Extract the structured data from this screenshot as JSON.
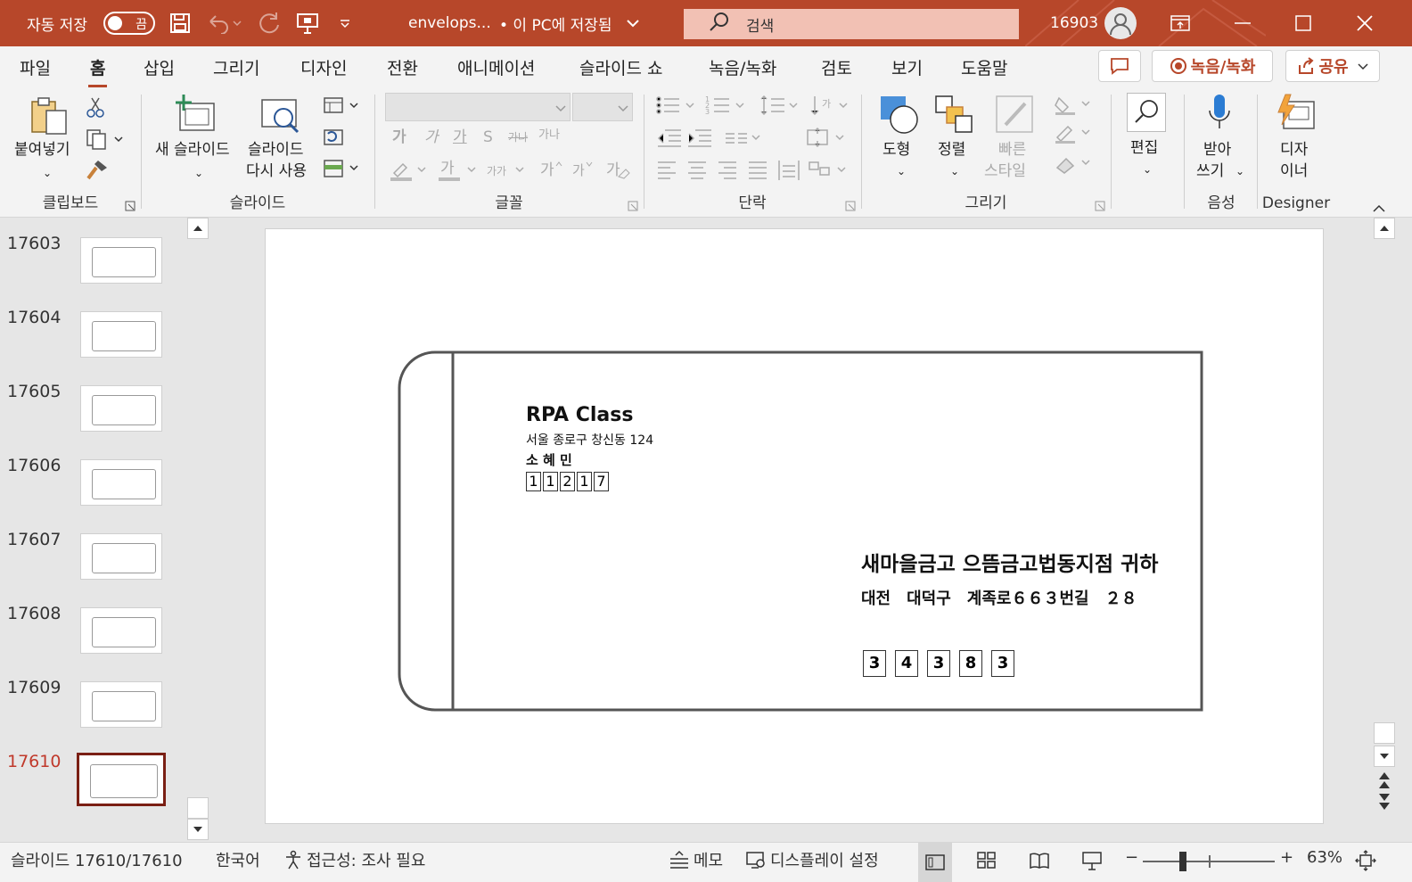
{
  "titlebar": {
    "autosave_label": "자동 저장",
    "autosave_state": "끔",
    "filename": "envelops...",
    "save_status": "• 이 PC에 저장됨",
    "search_placeholder": "검색",
    "user": "16903",
    "accent_color": "#b7472a"
  },
  "menu": {
    "tabs": [
      "파일",
      "홈",
      "삽입",
      "그리기",
      "디자인",
      "전환",
      "애니메이션",
      "슬라이드 쇼",
      "녹음/녹화",
      "검토",
      "보기",
      "도움말"
    ],
    "active": "홈",
    "record_button": "녹음/녹화",
    "share_button": "공유"
  },
  "ribbon": {
    "clipboard": {
      "paste": "붙여넣기",
      "group": "클립보드"
    },
    "slides": {
      "new_slide": "새 슬라이드",
      "reuse1": "슬라이드",
      "reuse2": "다시 사용",
      "group": "슬라이드"
    },
    "font": {
      "group": "글꼴",
      "bold": "가",
      "italic": "가",
      "underline": "가",
      "shadow": "S",
      "strike": "가나",
      "spacing": "가나"
    },
    "paragraph": {
      "group": "단락"
    },
    "drawing": {
      "shapes": "도형",
      "arrange": "정렬",
      "quick1": "빠른",
      "quick2": "스타일",
      "group": "그리기"
    },
    "editing": {
      "edit": "편집"
    },
    "voice": {
      "dictate1": "받아",
      "dictate2": "쓰기",
      "group": "음성"
    },
    "designer": {
      "d1": "디자",
      "d2": "이너",
      "group": "Designer"
    }
  },
  "thumbnails": [
    {
      "num": "17603"
    },
    {
      "num": "17604"
    },
    {
      "num": "17605"
    },
    {
      "num": "17606"
    },
    {
      "num": "17607"
    },
    {
      "num": "17608"
    },
    {
      "num": "17609"
    },
    {
      "num": "17610",
      "selected": true
    }
  ],
  "slide": {
    "sender_name": "RPA Class",
    "sender_address": "서울 종로구 창신동 124",
    "sender_person": "소 혜 민",
    "sender_zip": [
      "1",
      "1",
      "2",
      "1",
      "7"
    ],
    "recipient_name": "새마을금고 으뜸금고법동지점 귀하",
    "recipient_address": "대전　대덕구　계족로６６３번길　２８",
    "recipient_zip": [
      "3",
      "4",
      "3",
      "8",
      "3"
    ]
  },
  "status": {
    "slide_count": "슬라이드 17610/17610",
    "language": "한국어",
    "accessibility": "접근성: 조사 필요",
    "notes": "메모",
    "display": "디스플레이 설정",
    "zoom_minus": "−",
    "zoom_plus": "+",
    "zoom": "63%"
  }
}
